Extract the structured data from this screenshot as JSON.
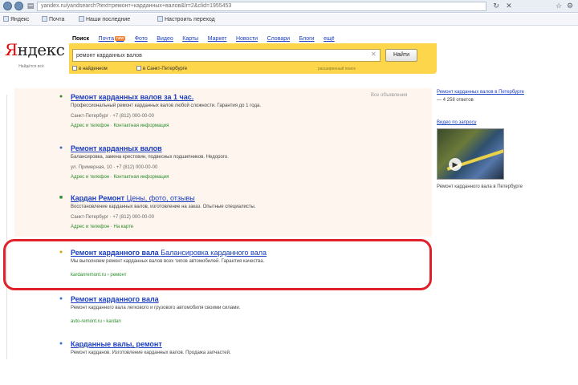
{
  "browser": {
    "url": "yandex.ru/yandsearch?text=ремонт+карданных+валов&lr=2&clid=1955453",
    "icons": [
      "back-icon",
      "forward-icon",
      "favorite-icon",
      "feed-icon",
      "home-icon"
    ]
  },
  "bookmarks": [
    {
      "label": "Яндекс"
    },
    {
      "label": "Почта"
    },
    {
      "label": "Наши последние"
    },
    {
      "label": "Настроить переход"
    }
  ],
  "header": {
    "logo_red": "Я",
    "logo_rest": "ндекс",
    "logo_sub": "Найдётся всё"
  },
  "tabs": [
    {
      "label": "Поиск",
      "active": true
    },
    {
      "label": "Почта",
      "badge": "new"
    },
    {
      "label": "Фото"
    },
    {
      "label": "Видео"
    },
    {
      "label": "Карты"
    },
    {
      "label": "Маркет"
    },
    {
      "label": "Новости"
    },
    {
      "label": "Словари"
    },
    {
      "label": "Блоги"
    },
    {
      "label": "ещё"
    }
  ],
  "search": {
    "query": "ремонт карданных валов",
    "clear_icon": "clear-icon",
    "button_label": "Найти",
    "option1": "в найденном",
    "option2": "в Санкт-Петербурге",
    "advanced": "расширенный поиск"
  },
  "ads_label": "Все объявления",
  "results": [
    {
      "title": "Ремонт карданных валов за 1 час.",
      "extra": "",
      "snippet": "Профессиональный ремонт карданных валов любой сложности. Гарантия до 1 года.",
      "meta": "Санкт-Петербург · +7 (812) 000-00-00",
      "green": "Адрес и телефон · Контактная информация",
      "fav": "●",
      "fav_color": "#2b8c2b"
    },
    {
      "title": "Ремонт карданных валов",
      "extra": "",
      "snippet": "Балансировка, замена крестовин, подвесных подшипников. Недорого.",
      "meta": "ул. Примерная, 10 · +7 (812) 000-00-00",
      "green": "Адрес и телефон · Контактная информация",
      "fav": "●",
      "fav_color": "#3b6fc4"
    },
    {
      "title": "Кардан Ремонт",
      "extra": "Цены, фото, отзывы",
      "snippet": "Восстановление карданных валов, изготовление на заказ. Опытные специалисты.",
      "meta": "Санкт-Петербург · +7 (812) 000-00-00",
      "green": "Адрес и телефон · На карте",
      "fav": "■",
      "fav_color": "#2b8c2b"
    },
    {
      "title": "Ремонт карданного вала",
      "extra": "Балансировка карданного вала",
      "snippet": "Мы выполняем ремонт карданных валов всех типов автомобилей. Гарантия качества.",
      "meta": "",
      "green": "kardanremont.ru › ремонт",
      "fav": "●",
      "fav_color": "#d9a400"
    },
    {
      "title": "Ремонт карданного вала",
      "extra": "",
      "snippet": "Ремонт карданного вала легкового и грузового автомобиля своими силами.",
      "meta": "",
      "green": "avto-remont.ru › kardan",
      "fav": "●",
      "fav_color": "#3b6fc4"
    },
    {
      "title": "Карданные валы, ремонт",
      "extra": "",
      "snippet": "Ремонт карданов. Изготовление карданных валов. Продажа запчастей.",
      "meta": "",
      "green": "",
      "fav": "●",
      "fav_color": "#3b6fc4"
    }
  ],
  "right_column": {
    "link1": "Ремонт карданных валов в Петербурге",
    "text1": "— 4 258 ответов",
    "video_link": "Видео по запросу",
    "video_caption": "Ремонт карданного вала в Петербурге",
    "play_icon": "play-icon"
  }
}
